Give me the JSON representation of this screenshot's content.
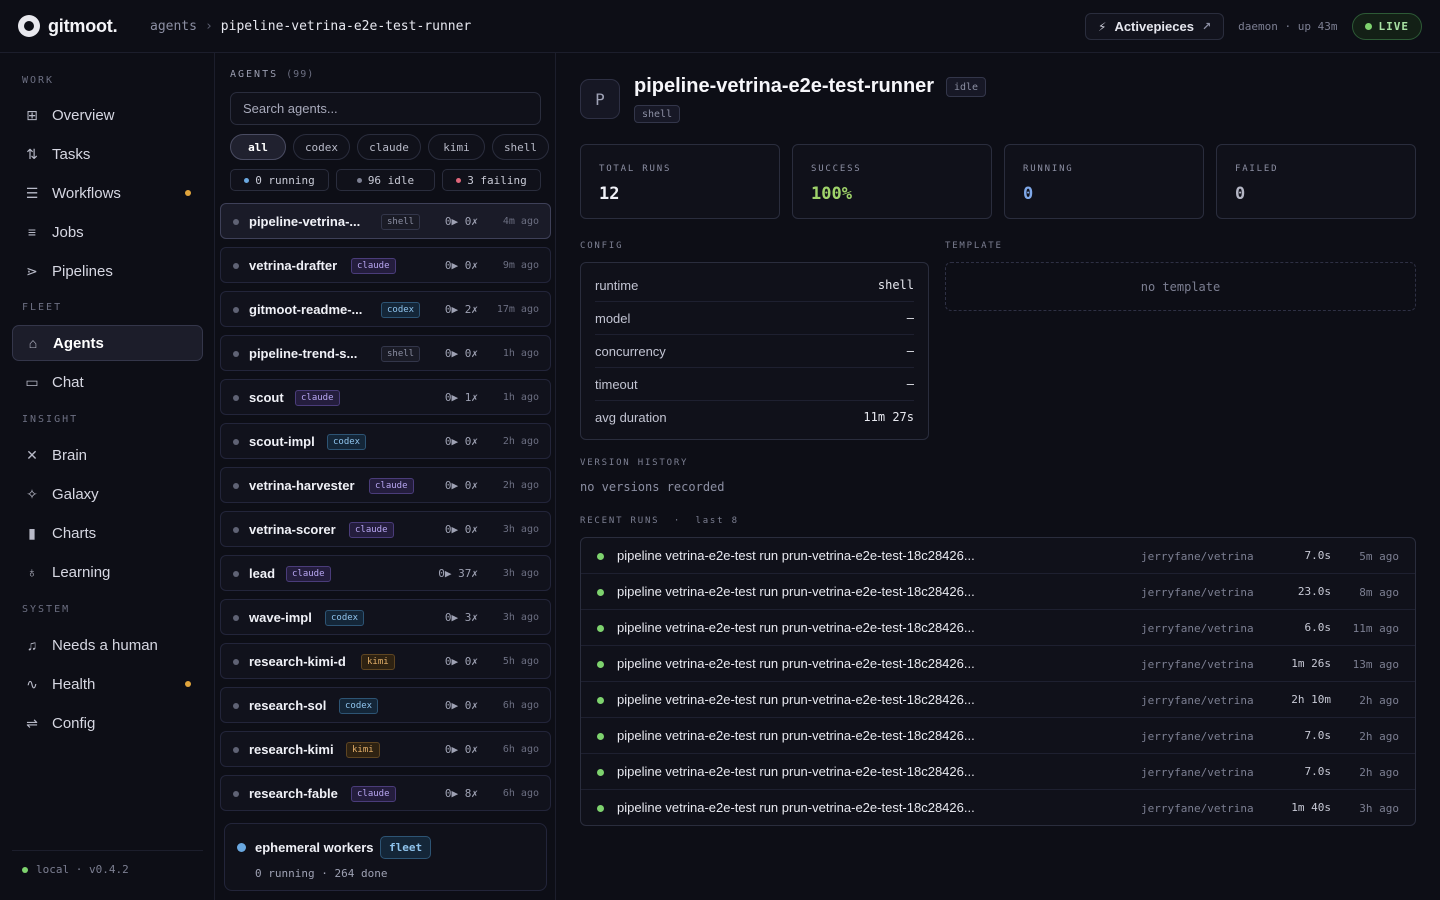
{
  "app": {
    "name": "gitmoot."
  },
  "breadcrumb": {
    "section": "agents",
    "sep": "›",
    "current": "pipeline-vetrina-e2e-test-runner"
  },
  "topbar": {
    "activepieces_label": "Activepieces",
    "activepieces_ext": "↗",
    "daemon_status": "daemon · up 43m",
    "live_label": "LIVE"
  },
  "sidebar": {
    "sections": [
      {
        "label": "WORK"
      },
      {
        "label": "FLEET"
      },
      {
        "label": "INSIGHT"
      },
      {
        "label": "SYSTEM"
      }
    ],
    "items": [
      {
        "label": "Overview",
        "icon": "grid-icon"
      },
      {
        "label": "Tasks",
        "icon": "tasks-icon"
      },
      {
        "label": "Workflows",
        "icon": "workflow-icon",
        "dot": true
      },
      {
        "label": "Jobs",
        "icon": "list-icon"
      },
      {
        "label": "Pipelines",
        "icon": "pipeline-icon"
      },
      {
        "label": "Agents",
        "icon": "robot-icon",
        "active": true
      },
      {
        "label": "Chat",
        "icon": "chat-icon"
      },
      {
        "label": "Brain",
        "icon": "brain-icon"
      },
      {
        "label": "Galaxy",
        "icon": "sparkle-icon"
      },
      {
        "label": "Charts",
        "icon": "bar-chart-icon"
      },
      {
        "label": "Learning",
        "icon": "bulb-icon"
      },
      {
        "label": "Needs a human",
        "icon": "bell-icon"
      },
      {
        "label": "Health",
        "icon": "pulse-icon",
        "dot": true
      },
      {
        "label": "Config",
        "icon": "sliders-icon"
      }
    ],
    "footer": "local · v0.4.2"
  },
  "agents": {
    "header": "AGENTS",
    "count": "(99)",
    "search_placeholder": "Search agents...",
    "filters": [
      "all",
      "codex",
      "claude",
      "kimi",
      "shell"
    ],
    "statuses": [
      {
        "label": "0 running",
        "color": "#6aa8e0"
      },
      {
        "label": "96 idle",
        "color": "#7c7f92"
      },
      {
        "label": "3 failing",
        "color": "#e0667a"
      }
    ],
    "list": [
      {
        "name": "pipeline-vetrina-...",
        "tag": "shell",
        "count": "0▶ 0✗",
        "ago": "4m ago",
        "active": true
      },
      {
        "name": "vetrina-drafter",
        "tag": "claude",
        "count": "0▶ 0✗",
        "ago": "9m ago"
      },
      {
        "name": "gitmoot-readme-...",
        "tag": "codex",
        "count": "0▶ 2✗",
        "ago": "17m ago"
      },
      {
        "name": "pipeline-trend-s...",
        "tag": "shell",
        "count": "0▶ 0✗",
        "ago": "1h ago"
      },
      {
        "name": "scout",
        "tag": "claude",
        "count": "0▶ 1✗",
        "ago": "1h ago"
      },
      {
        "name": "scout-impl",
        "tag": "codex",
        "count": "0▶ 0✗",
        "ago": "2h ago"
      },
      {
        "name": "vetrina-harvester",
        "tag": "claude",
        "count": "0▶ 0✗",
        "ago": "2h ago"
      },
      {
        "name": "vetrina-scorer",
        "tag": "claude",
        "count": "0▶ 0✗",
        "ago": "3h ago"
      },
      {
        "name": "lead",
        "tag": "claude",
        "count": "0▶ 37✗",
        "ago": "3h ago"
      },
      {
        "name": "wave-impl",
        "tag": "codex",
        "count": "0▶ 3✗",
        "ago": "3h ago"
      },
      {
        "name": "research-kimi-d",
        "tag": "kimi",
        "count": "0▶ 0✗",
        "ago": "5h ago"
      },
      {
        "name": "research-sol",
        "tag": "codex",
        "count": "0▶ 0✗",
        "ago": "6h ago"
      },
      {
        "name": "research-kimi",
        "tag": "kimi",
        "count": "0▶ 0✗",
        "ago": "6h ago"
      },
      {
        "name": "research-fable",
        "tag": "claude",
        "count": "0▶ 8✗",
        "ago": "6h ago"
      }
    ],
    "ephemeral": {
      "name": "ephemeral workers",
      "tag": "fleet",
      "status": "0 running  ·  264 done"
    }
  },
  "detail": {
    "avatar": "P",
    "title": "pipeline-vetrina-e2e-test-runner",
    "state": "idle",
    "runtime_tag": "shell",
    "stats": [
      {
        "label": "TOTAL RUNS",
        "value": "12",
        "color": "#f0f1f7"
      },
      {
        "label": "SUCCESS",
        "value": "100%",
        "color": "#9fd36a"
      },
      {
        "label": "RUNNING",
        "value": "0",
        "color": "#7fa8e8"
      },
      {
        "label": "FAILED",
        "value": "0",
        "color": "#b4b6c4"
      }
    ],
    "config_label": "CONFIG",
    "config": [
      {
        "key": "runtime",
        "value": "shell"
      },
      {
        "key": "model",
        "value": "—"
      },
      {
        "key": "concurrency",
        "value": "—"
      },
      {
        "key": "timeout",
        "value": "—"
      },
      {
        "key": "avg duration",
        "value": "11m 27s"
      }
    ],
    "template_label": "TEMPLATE",
    "template_empty": "no template",
    "version_label": "VERSION HISTORY",
    "version_empty": "no versions recorded",
    "runs_label": "RECENT RUNS  ·  last 8",
    "runs": [
      {
        "title": "pipeline vetrina-e2e-test run prun-vetrina-e2e-test-18c28426...",
        "repo": "jerryfane/vetrina",
        "duration": "7.0s",
        "ago": "5m ago"
      },
      {
        "title": "pipeline vetrina-e2e-test run prun-vetrina-e2e-test-18c28426...",
        "repo": "jerryfane/vetrina",
        "duration": "23.0s",
        "ago": "8m ago"
      },
      {
        "title": "pipeline vetrina-e2e-test run prun-vetrina-e2e-test-18c28426...",
        "repo": "jerryfane/vetrina",
        "duration": "6.0s",
        "ago": "11m ago"
      },
      {
        "title": "pipeline vetrina-e2e-test run prun-vetrina-e2e-test-18c28426...",
        "repo": "jerryfane/vetrina",
        "duration": "1m 26s",
        "ago": "13m ago"
      },
      {
        "title": "pipeline vetrina-e2e-test run prun-vetrina-e2e-test-18c28426...",
        "repo": "jerryfane/vetrina",
        "duration": "2h 10m",
        "ago": "2h ago"
      },
      {
        "title": "pipeline vetrina-e2e-test run prun-vetrina-e2e-test-18c28426...",
        "repo": "jerryfane/vetrina",
        "duration": "7.0s",
        "ago": "2h ago"
      },
      {
        "title": "pipeline vetrina-e2e-test run prun-vetrina-e2e-test-18c28426...",
        "repo": "jerryfane/vetrina",
        "duration": "7.0s",
        "ago": "2h ago"
      },
      {
        "title": "pipeline vetrina-e2e-test run prun-vetrina-e2e-test-18c28426...",
        "repo": "jerryfane/vetrina",
        "duration": "1m 40s",
        "ago": "3h ago"
      }
    ]
  }
}
